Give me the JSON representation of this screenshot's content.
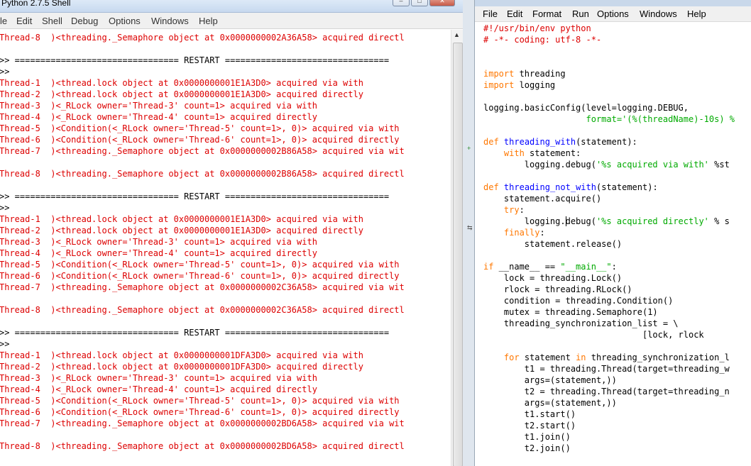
{
  "shell": {
    "title": "Python 2.7.5 Shell",
    "window_controls": [
      "–",
      "□",
      "✕"
    ],
    "menu": [
      "le",
      "Edit",
      "Shell",
      "Debug",
      "Options",
      "Windows",
      "Help"
    ],
    "lines": [
      {
        "text": "Thread-8  )<threading._Semaphore object at 0x0000000002A36A58> acquired directl",
        "style": "output"
      },
      {
        "text": "",
        "style": "output"
      },
      {
        "text": ">> ================================ RESTART ================================",
        "style": "prompt"
      },
      {
        "text": ">>",
        "style": "prompt"
      },
      {
        "text": "Thread-1  )<thread.lock object at 0x0000000001E1A3D0> acquired via with",
        "style": "output"
      },
      {
        "text": "Thread-2  )<thread.lock object at 0x0000000001E1A3D0> acquired directly",
        "style": "output"
      },
      {
        "text": "Thread-3  )<_RLock owner='Thread-3' count=1> acquired via with",
        "style": "output"
      },
      {
        "text": "Thread-4  )<_RLock owner='Thread-4' count=1> acquired directly",
        "style": "output"
      },
      {
        "text": "Thread-5  )<Condition(<_RLock owner='Thread-5' count=1>, 0)> acquired via with",
        "style": "output"
      },
      {
        "text": "Thread-6  )<Condition(<_RLock owner='Thread-6' count=1>, 0)> acquired directly",
        "style": "output"
      },
      {
        "text": "Thread-7  )<threading._Semaphore object at 0x0000000002B86A58> acquired via wit",
        "style": "output"
      },
      {
        "text": "",
        "style": "output"
      },
      {
        "text": "Thread-8  )<threading._Semaphore object at 0x0000000002B86A58> acquired directl",
        "style": "output"
      },
      {
        "text": "",
        "style": "output"
      },
      {
        "text": ">> ================================ RESTART ================================",
        "style": "prompt"
      },
      {
        "text": ">>",
        "style": "prompt"
      },
      {
        "text": "Thread-1  )<thread.lock object at 0x0000000001E1A3D0> acquired via with",
        "style": "output"
      },
      {
        "text": "Thread-2  )<thread.lock object at 0x0000000001E1A3D0> acquired directly",
        "style": "output"
      },
      {
        "text": "Thread-3  )<_RLock owner='Thread-3' count=1> acquired via with",
        "style": "output"
      },
      {
        "text": "Thread-4  )<_RLock owner='Thread-4' count=1> acquired directly",
        "style": "output"
      },
      {
        "text": "Thread-5  )<Condition(<_RLock owner='Thread-5' count=1>, 0)> acquired via with",
        "style": "output"
      },
      {
        "text": "Thread-6  )<Condition(<_RLock owner='Thread-6' count=1>, 0)> acquired directly",
        "style": "output"
      },
      {
        "text": "Thread-7  )<threading._Semaphore object at 0x0000000002C36A58> acquired via wit",
        "style": "output"
      },
      {
        "text": "",
        "style": "output"
      },
      {
        "text": "Thread-8  )<threading._Semaphore object at 0x0000000002C36A58> acquired directl",
        "style": "output"
      },
      {
        "text": "",
        "style": "output"
      },
      {
        "text": ">> ================================ RESTART ================================",
        "style": "prompt"
      },
      {
        "text": ">>",
        "style": "prompt"
      },
      {
        "text": "Thread-1  )<thread.lock object at 0x0000000001DFA3D0> acquired via with",
        "style": "output"
      },
      {
        "text": "Thread-2  )<thread.lock object at 0x0000000001DFA3D0> acquired directly",
        "style": "output"
      },
      {
        "text": "Thread-3  )<_RLock owner='Thread-3' count=1> acquired via with",
        "style": "output"
      },
      {
        "text": "Thread-4  )<_RLock owner='Thread-4' count=1> acquired directly",
        "style": "output"
      },
      {
        "text": "Thread-5  )<Condition(<_RLock owner='Thread-5' count=1>, 0)> acquired via with",
        "style": "output"
      },
      {
        "text": "Thread-6  )<Condition(<_RLock owner='Thread-6' count=1>, 0)> acquired directly",
        "style": "output"
      },
      {
        "text": "Thread-7  )<threading._Semaphore object at 0x0000000002BD6A58> acquired via wit",
        "style": "output"
      },
      {
        "text": "",
        "style": "output"
      },
      {
        "text": "Thread-8  )<threading._Semaphore object at 0x0000000002BD6A58> acquired directl",
        "style": "output"
      }
    ]
  },
  "editor": {
    "menu": [
      "File",
      "Edit",
      "Format",
      "Run",
      "Options",
      "Windows",
      "Help"
    ],
    "code": [
      [
        [
          "#!/usr/bin/env python",
          "cmt"
        ]
      ],
      [
        [
          "# -*- coding: utf-8 -*-",
          "cmt"
        ]
      ],
      [],
      [],
      [
        [
          "import",
          "kw"
        ],
        [
          " threading",
          ""
        ]
      ],
      [
        [
          "import",
          "kw"
        ],
        [
          " logging",
          ""
        ]
      ],
      [],
      [
        [
          "logging.basicConfig(level=logging.DEBUG,",
          ""
        ]
      ],
      [
        [
          "                    ",
          ""
        ],
        [
          "format='(%(threadName)-10s) %",
          "str"
        ]
      ],
      [],
      [
        [
          "def",
          "kw"
        ],
        [
          " ",
          ""
        ],
        [
          "threading_with",
          "def"
        ],
        [
          "(statement):",
          ""
        ]
      ],
      [
        [
          "    ",
          ""
        ],
        [
          "with",
          "kw"
        ],
        [
          " statement:",
          ""
        ]
      ],
      [
        [
          "        logging.debug(",
          ""
        ],
        [
          "'%s acquired via with'",
          "str"
        ],
        [
          " %st",
          ""
        ]
      ],
      [],
      [
        [
          "def",
          "kw"
        ],
        [
          " ",
          ""
        ],
        [
          "threading_not_with",
          "def"
        ],
        [
          "(statement):",
          ""
        ]
      ],
      [
        [
          "    statement.acquire()",
          ""
        ]
      ],
      [
        [
          "    ",
          ""
        ],
        [
          "try",
          "kw"
        ],
        [
          ":",
          ""
        ]
      ],
      [
        [
          "        logging.debug(",
          ""
        ],
        [
          "'%s acquired directly'",
          "str"
        ],
        [
          " % s",
          ""
        ]
      ],
      [
        [
          "    ",
          ""
        ],
        [
          "finally",
          "kw"
        ],
        [
          ":",
          ""
        ]
      ],
      [
        [
          "        statement.release()",
          ""
        ]
      ],
      [],
      [
        [
          "if",
          "kw"
        ],
        [
          " __name__ == ",
          ""
        ],
        [
          "\"__main__\"",
          "str"
        ],
        [
          ":",
          ""
        ]
      ],
      [
        [
          "    lock = threading.Lock()",
          ""
        ]
      ],
      [
        [
          "    rlock = threading.RLock()",
          ""
        ]
      ],
      [
        [
          "    condition = threading.Condition()",
          ""
        ]
      ],
      [
        [
          "    mutex = threading.Semaphore(1)",
          ""
        ]
      ],
      [
        [
          "    threading_synchronization_list = \\",
          ""
        ]
      ],
      [
        [
          "                               [lock, rlock",
          ""
        ]
      ],
      [],
      [
        [
          "    ",
          ""
        ],
        [
          "for",
          "kw"
        ],
        [
          " statement ",
          ""
        ],
        [
          "in",
          "kw"
        ],
        [
          " threading_synchronization_l",
          ""
        ]
      ],
      [
        [
          "        t1 = threading.Thread(target=threading_w",
          ""
        ]
      ],
      [
        [
          "        args=(statement,))",
          ""
        ]
      ],
      [
        [
          "        t2 = threading.Thread(target=threading_n",
          ""
        ]
      ],
      [
        [
          "        args=(statement,))",
          ""
        ]
      ],
      [
        [
          "        t1.start()",
          ""
        ]
      ],
      [
        [
          "        t2.start()",
          ""
        ]
      ],
      [
        [
          "        t1.join()",
          ""
        ]
      ],
      [
        [
          "        t2.join()",
          ""
        ]
      ]
    ]
  },
  "background_window": {
    "marks": [
      "+",
      "⇆"
    ]
  }
}
